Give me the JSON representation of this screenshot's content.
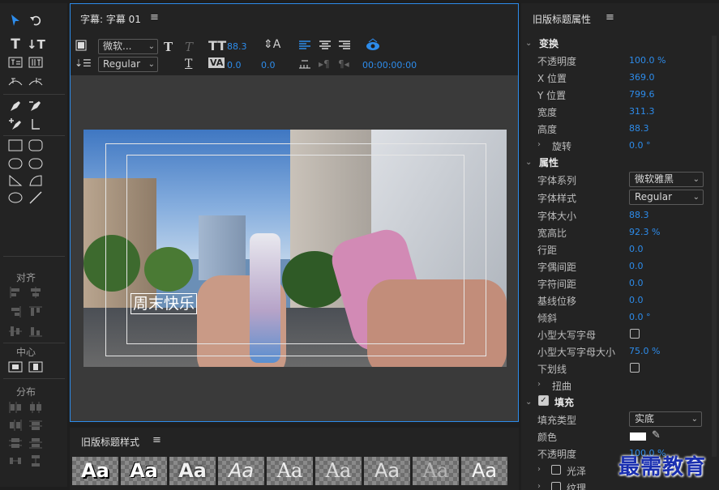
{
  "editor": {
    "title": "字幕: 字幕 01",
    "menu_icon": "≡",
    "font_family": "微软...",
    "font_style": "Regular",
    "font_size": "88.3",
    "kerning": "0.0",
    "leading": "0.0",
    "timecode": "00:00:00:00",
    "subtitle_text": "周末快乐"
  },
  "tools": {
    "align_label": "对齐",
    "center_label": "中心",
    "distribute_label": "分布"
  },
  "props": {
    "title": "旧版标题属性",
    "menu_icon": "≡",
    "transform_section": "变换",
    "opacity_label": "不透明度",
    "opacity_value": "100.0 %",
    "xpos_label": "X 位置",
    "xpos_value": "369.0",
    "ypos_label": "Y 位置",
    "ypos_value": "799.6",
    "width_label": "宽度",
    "width_value": "311.3",
    "height_label": "高度",
    "height_value": "88.3",
    "rotation_label": "旋转",
    "rotation_value": "0.0 °",
    "attributes_section": "属性",
    "font_family_label": "字体系列",
    "font_family_value": "微软雅黑",
    "font_style_label": "字体样式",
    "font_style_value": "Regular",
    "font_size_label": "字体大小",
    "font_size_value": "88.3",
    "aspect_label": "宽高比",
    "aspect_value": "92.3 %",
    "leading_label": "行距",
    "leading_value": "0.0",
    "kerning_label": "字偶间距",
    "kerning_value": "0.0",
    "tracking_label": "字符间距",
    "tracking_value": "0.0",
    "baseline_label": "基线位移",
    "baseline_value": "0.0",
    "slant_label": "倾斜",
    "slant_value": "0.0 °",
    "smallcaps_label": "小型大写字母",
    "smallcaps_size_label": "小型大写字母大小",
    "smallcaps_size_value": "75.0 %",
    "underline_label": "下划线",
    "distort_label": "扭曲",
    "fill_section": "填充",
    "fill_type_label": "填充类型",
    "fill_type_value": "实底",
    "color_label": "颜色",
    "fill_opacity_label": "不透明度",
    "fill_opacity_value": "100.0 %",
    "sheen_label": "光泽",
    "texture_label": "纹理"
  },
  "styles": {
    "title": "旧版标题样式",
    "menu_icon": "≡",
    "swatch_text": "Aa"
  },
  "watermark": "最需教育",
  "colors": {
    "accent": "#2d8ceb",
    "panel": "#232323",
    "canvas_bg": "#3a3a3a",
    "watermark": "#1a2fb0"
  }
}
